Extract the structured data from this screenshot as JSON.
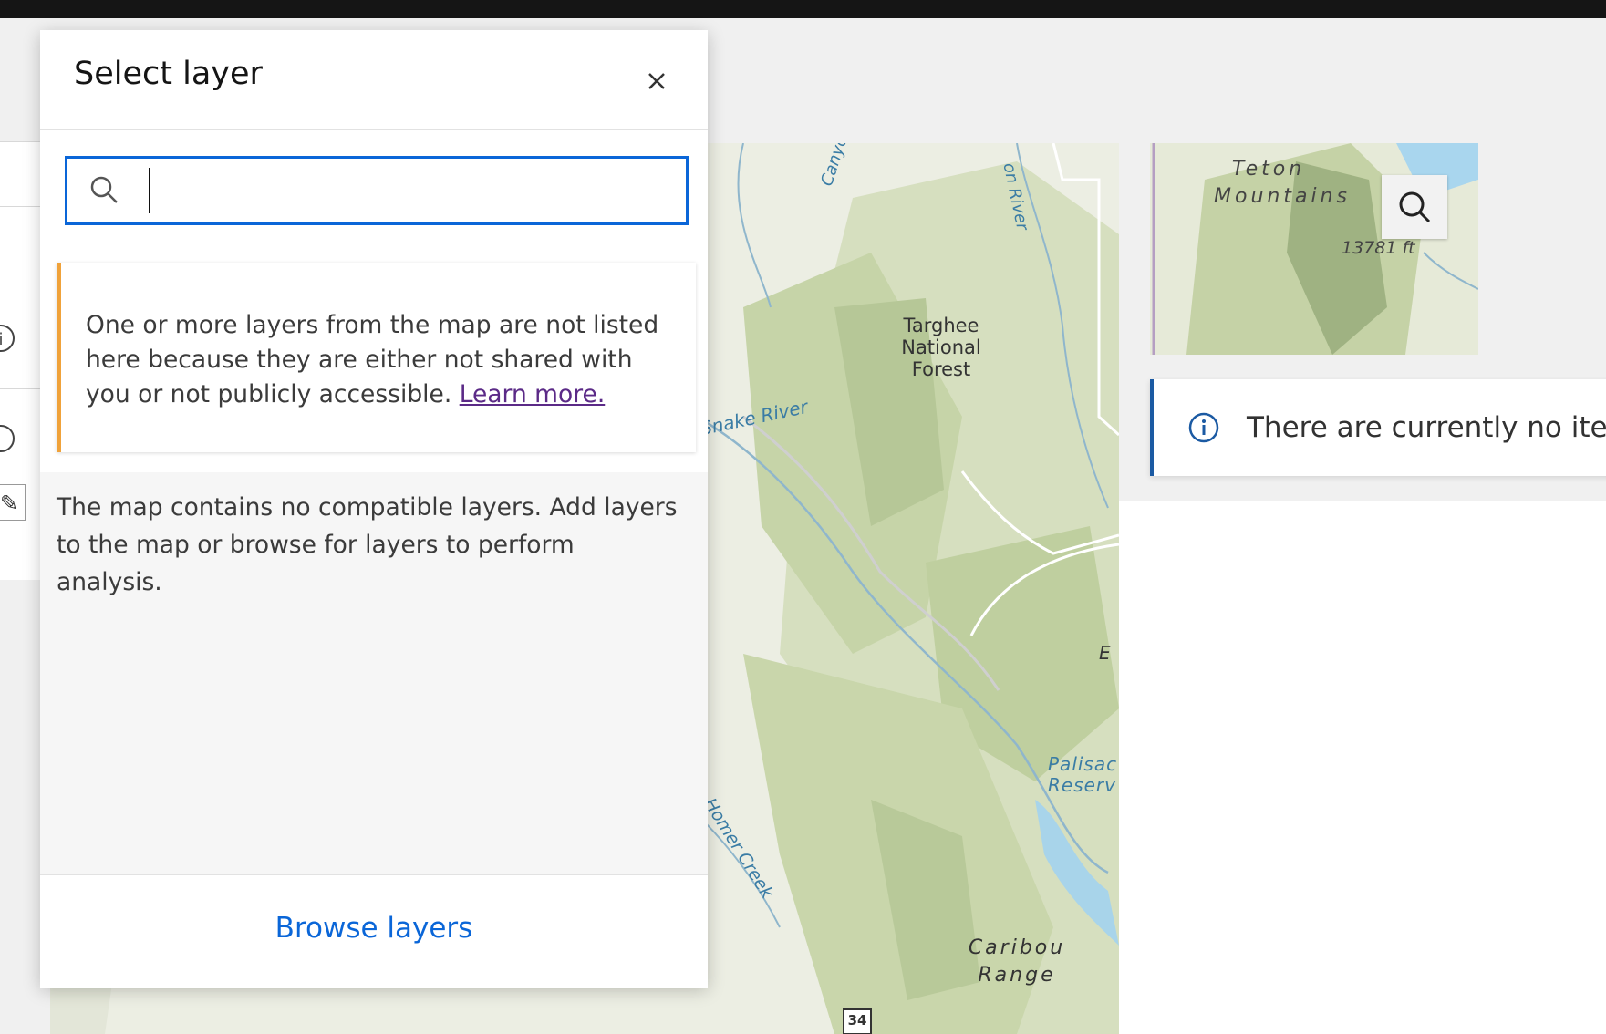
{
  "dialog": {
    "title": "Select layer",
    "close_icon": "close-icon",
    "search": {
      "placeholder": "",
      "value": "",
      "icon": "search-icon"
    },
    "warning": {
      "text": "One or more layers from the map are not listed here because they are either not shared with you or not publicly accessible.",
      "link": "Learn more."
    },
    "empty_message": "The map contains no compatible layers. Add layers to the map or browse for layers to perform analysis.",
    "footer_button": "Browse layers"
  },
  "map_labels": {
    "canyon_creek": "Canyon Creek",
    "river_top": "on River",
    "targhee": "Targhee National Forest",
    "snake_river": "Snake River",
    "palisades": "Palisac Reserv",
    "homer_creek": "Homer Creek",
    "caribou": "Caribou Range",
    "route": "34",
    "edge_letter": "E"
  },
  "overview": {
    "teton": "Teton Mountains",
    "elevation": "13781 ft",
    "search_icon": "search-icon"
  },
  "notice": {
    "icon": "info-icon",
    "text": "There are currently no item"
  },
  "colors": {
    "accent": "#0a66d8",
    "warning": "#f0a23a",
    "notice_border": "#1b5aa3",
    "link_visited": "#5b2a87"
  }
}
